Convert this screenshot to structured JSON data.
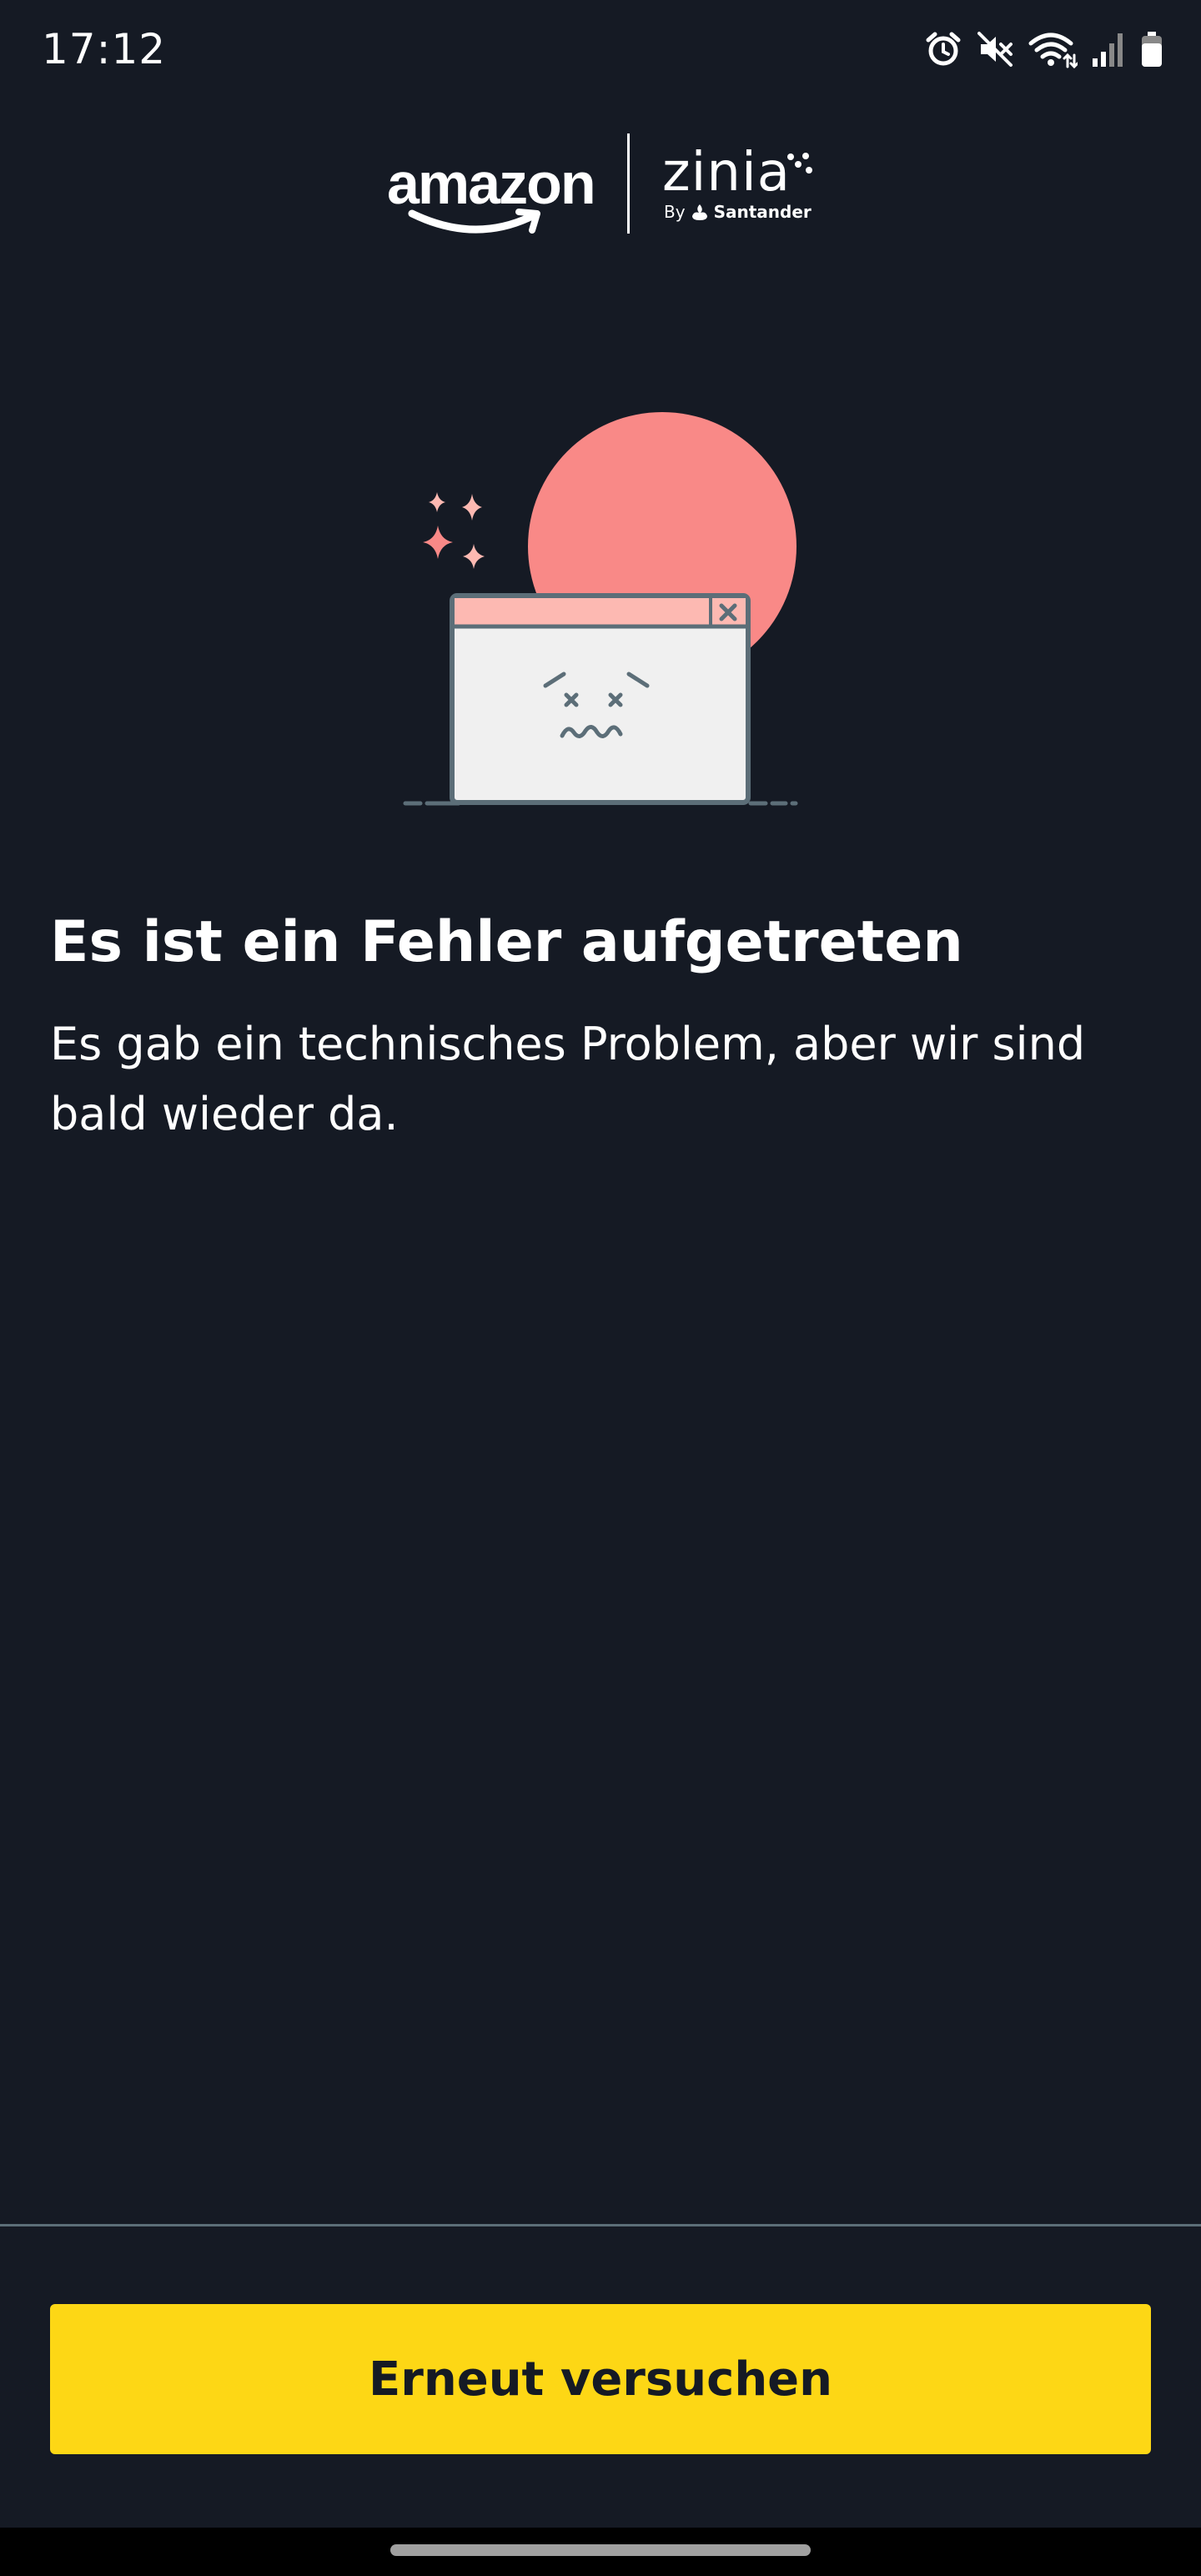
{
  "status_bar": {
    "time": "17:12",
    "icons": [
      "alarm-icon",
      "mute-icon",
      "wifi-icon",
      "signal-icon",
      "battery-icon"
    ]
  },
  "header": {
    "brand_primary": "amazon",
    "brand_secondary": "zinia",
    "brand_by": "By",
    "brand_partner": "Santander"
  },
  "illustration": {
    "subject": "error-window-illustration",
    "colors": {
      "circle": "#f98987",
      "window_bar": "#fdb9b2",
      "window_body": "#f0f0f0",
      "outline": "#5c6e78",
      "sparkle": "#fdb9b2"
    }
  },
  "error": {
    "title": "Es ist ein Fehler aufgetreten",
    "description": "Es gab ein technisches Problem, aber wir sind bald wieder da."
  },
  "footer": {
    "retry_label": "Erneut versuchen"
  },
  "colors": {
    "background": "#151a24",
    "button": "#fdd715",
    "divider": "#5c6e78"
  }
}
